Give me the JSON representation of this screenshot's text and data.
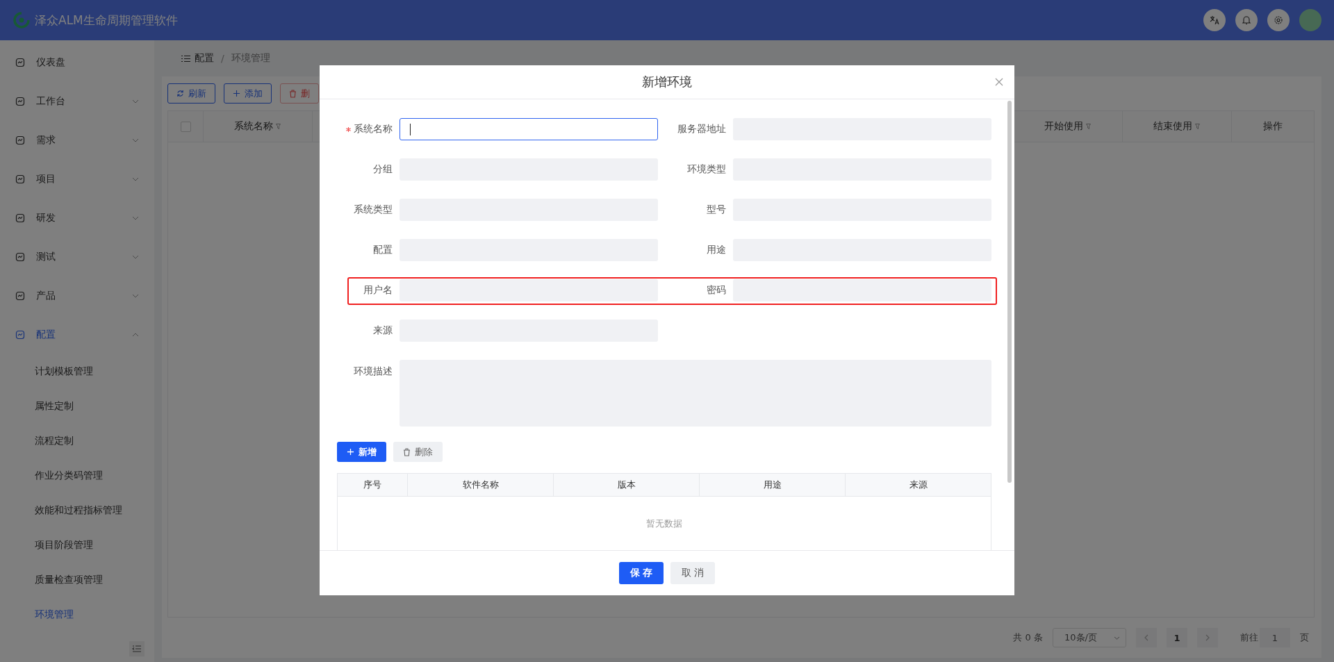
{
  "header": {
    "app_title": "泽众ALM生命周期管理软件"
  },
  "sidebar": {
    "items": [
      {
        "label": "仪表盘",
        "expandable": false,
        "selected": false
      },
      {
        "label": "工作台",
        "expandable": true,
        "expanded": false,
        "selected": false
      },
      {
        "label": "需求",
        "expandable": true,
        "expanded": false,
        "selected": false
      },
      {
        "label": "项目",
        "expandable": true,
        "expanded": false,
        "selected": false
      },
      {
        "label": "研发",
        "expandable": true,
        "expanded": false,
        "selected": false
      },
      {
        "label": "测试",
        "expandable": true,
        "expanded": false,
        "selected": false
      },
      {
        "label": "产品",
        "expandable": true,
        "expanded": false,
        "selected": false
      },
      {
        "label": "配置",
        "expandable": true,
        "expanded": true,
        "selected": true,
        "children": [
          {
            "label": "计划模板管理",
            "selected": false
          },
          {
            "label": "属性定制",
            "selected": false
          },
          {
            "label": "流程定制",
            "selected": false
          },
          {
            "label": "作业分类码管理",
            "selected": false
          },
          {
            "label": "效能和过程指标管理",
            "selected": false
          },
          {
            "label": "项目阶段管理",
            "selected": false
          },
          {
            "label": "质量检查项管理",
            "selected": false
          },
          {
            "label": "环境管理",
            "selected": true
          }
        ]
      }
    ]
  },
  "breadcrumb": {
    "items": [
      "配置",
      "环境管理"
    ],
    "separator": "/"
  },
  "toolbar": [
    {
      "label": "刷新",
      "kind": "refresh"
    },
    {
      "label": "添加",
      "kind": "add"
    },
    {
      "label": "删",
      "kind": "delete"
    }
  ],
  "table": {
    "select_all_checked": false,
    "columns_left": [
      {
        "label": "系统名称",
        "filterable": true
      }
    ],
    "columns_right": [
      {
        "label": "开始使用",
        "filterable": true
      },
      {
        "label": "结束使用",
        "filterable": true
      },
      {
        "label": "操作",
        "filterable": false
      }
    ]
  },
  "pagination": {
    "total": "共 0 条",
    "page_size": "10条/页",
    "current_page": "1",
    "goto_label": "前往",
    "goto_value": "1",
    "page_suffix": "页"
  },
  "dialog": {
    "title": "新增环境",
    "fields": [
      {
        "label": "系统名称",
        "kind": "input",
        "required": true,
        "focused": true
      },
      {
        "label": "服务器地址",
        "kind": "input",
        "required": false,
        "focused": false
      },
      {
        "label": "分组",
        "kind": "input",
        "required": false,
        "focused": false
      },
      {
        "label": "环境类型",
        "kind": "input",
        "required": false,
        "focused": false
      },
      {
        "label": "系统类型",
        "kind": "input",
        "required": false,
        "focused": false
      },
      {
        "label": "型号",
        "kind": "input",
        "required": false,
        "focused": false
      },
      {
        "label": "配置",
        "kind": "input",
        "required": false,
        "focused": false
      },
      {
        "label": "用途",
        "kind": "input",
        "required": false,
        "focused": false
      },
      {
        "label": "用户名",
        "kind": "input",
        "required": false,
        "focused": false
      },
      {
        "label": "密码",
        "kind": "input",
        "required": false,
        "focused": false
      },
      {
        "label": "来源",
        "kind": "input",
        "required": false,
        "focused": false
      },
      {
        "label": "环境描述",
        "kind": "textarea",
        "required": false,
        "focused": false
      }
    ],
    "sub_buttons": [
      {
        "label": "新增",
        "kind": "add"
      },
      {
        "label": "删除",
        "kind": "delete"
      }
    ],
    "sub_table": {
      "columns": [
        "序号",
        "软件名称",
        "版本",
        "用途",
        "来源"
      ],
      "empty_text": "暂无数据"
    },
    "footer_buttons": [
      {
        "label": "保 存",
        "kind": "primary"
      },
      {
        "label": "取 消",
        "kind": "default"
      }
    ]
  }
}
